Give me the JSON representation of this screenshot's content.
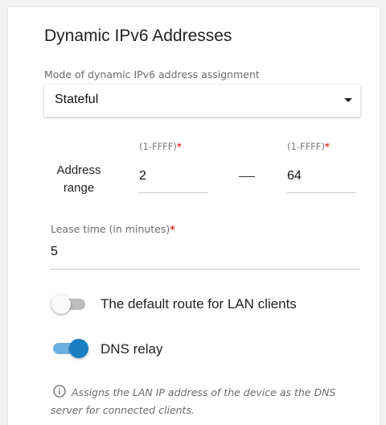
{
  "section": {
    "title": "Dynamic IPv6 Addresses"
  },
  "mode": {
    "label": "Mode of dynamic IPv6 address assignment",
    "value": "Stateful"
  },
  "address_range": {
    "label_line1": "Address",
    "label_line2": "range",
    "start_hint": "(1-FFFF)",
    "start_value": "2",
    "end_hint": "(1-FFFF)",
    "end_value": "64",
    "required_mark": "*"
  },
  "lease_time": {
    "label": "Lease time (in minutes)",
    "required_mark": "*",
    "value": "5"
  },
  "default_route_toggle": {
    "label": "The default route for LAN clients",
    "state": "off"
  },
  "dns_relay_toggle": {
    "label": "DNS relay",
    "state": "on"
  },
  "info": {
    "icon": "info-icon",
    "text": "Assigns the LAN IP address of the device as the DNS server for connected clients."
  },
  "colors": {
    "accent": "#1a7fc1",
    "accent_track": "#6ab0e0",
    "required": "#d9342b"
  }
}
